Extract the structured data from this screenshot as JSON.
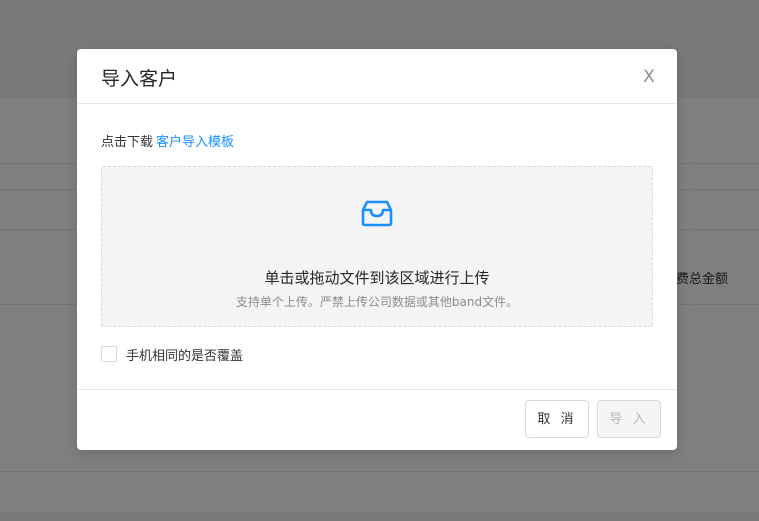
{
  "background": {
    "right_cell_text": "费总金额"
  },
  "modal": {
    "title": "导入客户",
    "close_label": "X",
    "download_prefix": "点击下载",
    "download_link": "客户导入模板",
    "upload": {
      "icon": "inbox-icon",
      "title": "单击或拖动文件到该区域进行上传",
      "hint": "支持单个上传。严禁上传公司数据或其他band文件。"
    },
    "overwrite_checkbox": {
      "label": "手机相同的是否覆盖",
      "checked": false
    },
    "buttons": {
      "cancel": "取 消",
      "import": "导 入",
      "import_disabled": true
    }
  },
  "colors": {
    "accent": "#1890ff",
    "mask": "rgba(0,0,0,0.5)"
  }
}
